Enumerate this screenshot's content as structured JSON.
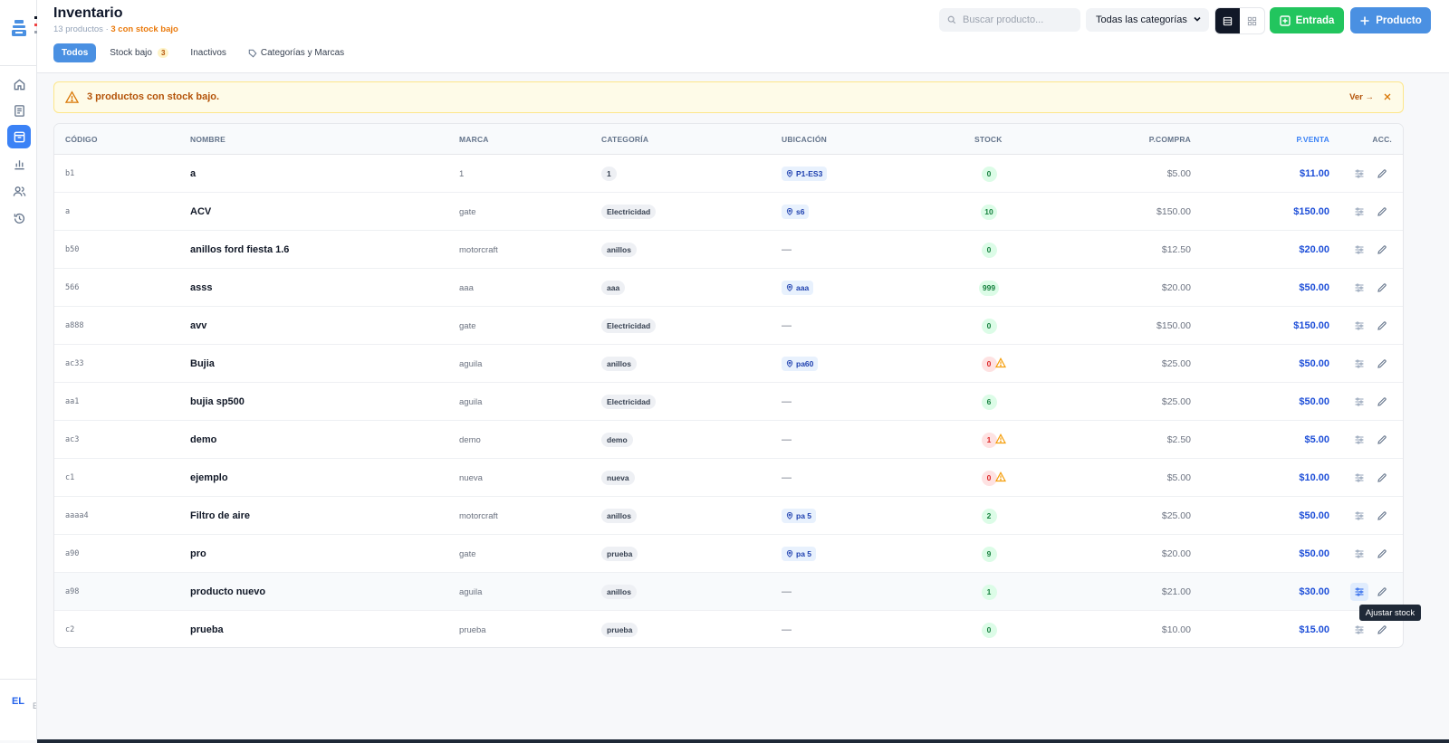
{
  "colors": {
    "accent": "#4a90e2",
    "success": "#22c55e",
    "warning": "#b45309",
    "danger": "#dc2626"
  },
  "sidebar": {
    "items": [
      {
        "icon": "home-icon",
        "active": false
      },
      {
        "icon": "receipt-icon",
        "active": false
      },
      {
        "icon": "inventory-box-icon",
        "active": true
      },
      {
        "icon": "bar-chart-icon",
        "active": false
      },
      {
        "icon": "users-icon",
        "active": false
      },
      {
        "icon": "history-icon",
        "active": false
      }
    ],
    "avatar_initials": "EL",
    "avatar_tail": "E"
  },
  "header": {
    "title": "Inventario",
    "count_text": "13 productos · ",
    "low_stock_text": "3 con stock bajo",
    "tabs": [
      {
        "label": "Todos",
        "active": true
      },
      {
        "label": "Stock bajo",
        "badge": "3"
      },
      {
        "label": "Inactivos"
      },
      {
        "label": "Categorías y Marcas",
        "icon": "tag-icon"
      }
    ],
    "search_placeholder": "Buscar producto...",
    "category_select": "Todas las categorías",
    "entrada_label": "Entrada",
    "producto_label": "Producto"
  },
  "alert": {
    "text": "3 productos con stock bajo.",
    "link": "Ver →"
  },
  "table": {
    "columns": [
      "CÓDIGO",
      "NOMBRE",
      "MARCA",
      "CATEGORÍA",
      "UBICACIÓN",
      "STOCK",
      "P.COMPRA",
      "P.VENTA",
      "ACC."
    ],
    "rows": [
      {
        "code": "b1",
        "name": "a",
        "brand": "1",
        "category": "1",
        "location": "P1-ES3",
        "stock": "0",
        "low": false,
        "cost": "$5.00",
        "price": "$11.00"
      },
      {
        "code": "a",
        "name": "ACV",
        "brand": "gate",
        "category": "Electricidad",
        "location": "s6",
        "stock": "10",
        "low": false,
        "cost": "$150.00",
        "price": "$150.00"
      },
      {
        "code": "b50",
        "name": "anillos ford fiesta 1.6",
        "brand": "motorcraft",
        "category": "anillos",
        "location": "—",
        "stock": "0",
        "low": false,
        "cost": "$12.50",
        "price": "$20.00"
      },
      {
        "code": "566",
        "name": "asss",
        "brand": "aaa",
        "category": "aaa",
        "location": "aaa",
        "stock": "999",
        "low": false,
        "cost": "$20.00",
        "price": "$50.00"
      },
      {
        "code": "a888",
        "name": "avv",
        "brand": "gate",
        "category": "Electricidad",
        "location": "—",
        "stock": "0",
        "low": false,
        "cost": "$150.00",
        "price": "$150.00"
      },
      {
        "code": "ac33",
        "name": "Bujia",
        "brand": "aguila",
        "category": "anillos",
        "location": "pa60",
        "stock": "0",
        "low": true,
        "cost": "$25.00",
        "price": "$50.00"
      },
      {
        "code": "aa1",
        "name": "bujia sp500",
        "brand": "aguila",
        "category": "Electricidad",
        "location": "—",
        "stock": "6",
        "low": false,
        "cost": "$25.00",
        "price": "$50.00"
      },
      {
        "code": "ac3",
        "name": "demo",
        "brand": "demo",
        "category": "demo",
        "location": "—",
        "stock": "1",
        "low": true,
        "cost": "$2.50",
        "price": "$5.00"
      },
      {
        "code": "c1",
        "name": "ejemplo",
        "brand": "nueva",
        "category": "nueva",
        "location": "—",
        "stock": "0",
        "low": true,
        "cost": "$5.00",
        "price": "$10.00"
      },
      {
        "code": "aaaa4",
        "name": "Filtro de aire",
        "brand": "motorcraft",
        "category": "anillos",
        "location": "pa 5",
        "stock": "2",
        "low": false,
        "cost": "$25.00",
        "price": "$50.00"
      },
      {
        "code": "a90",
        "name": "pro",
        "brand": "gate",
        "category": "prueba",
        "location": "pa 5",
        "stock": "9",
        "low": false,
        "cost": "$20.00",
        "price": "$50.00"
      },
      {
        "code": "a98",
        "name": "producto nuevo",
        "brand": "aguila",
        "category": "anillos",
        "location": "—",
        "stock": "1",
        "low": false,
        "cost": "$21.00",
        "price": "$30.00",
        "hover": true
      },
      {
        "code": "c2",
        "name": "prueba",
        "brand": "prueba",
        "category": "prueba",
        "location": "—",
        "stock": "0",
        "low": false,
        "cost": "$10.00",
        "price": "$15.00"
      }
    ]
  },
  "tooltip": "Ajustar stock"
}
